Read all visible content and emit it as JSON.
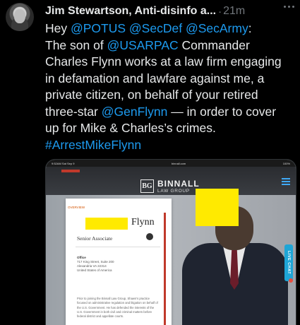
{
  "author": {
    "display_name": "Jim Stewartson, Anti-disinfo a...",
    "separator": "·",
    "time": "21m"
  },
  "tweet_lines": [
    [
      {
        "t": "Hey ",
        "m": false
      },
      {
        "t": "@POTUS",
        "m": true
      },
      {
        "t": " ",
        "m": false
      },
      {
        "t": "@SecDef",
        "m": true
      },
      {
        "t": " ",
        "m": false
      },
      {
        "t": "@SecArmy",
        "m": true
      },
      {
        "t": ":",
        "m": false
      }
    ],
    [
      {
        "t": "The son of ",
        "m": false
      },
      {
        "t": "@USARPAC",
        "m": true
      },
      {
        "t": " Commander",
        "m": false
      }
    ],
    [
      {
        "t": "Charles Flynn works at a law firm engaging",
        "m": false
      }
    ],
    [
      {
        "t": "in defamation and lawfare against me, a",
        "m": false
      }
    ],
    [
      {
        "t": "private citizen, on behalf of your retired",
        "m": false
      }
    ],
    [
      {
        "t": "three-star ",
        "m": false
      },
      {
        "t": "@GenFlynn",
        "m": true
      },
      {
        "t": " — in order to cover",
        "m": false
      }
    ],
    [
      {
        "t": "up for Mike & Charles’s crimes.",
        "m": false
      }
    ],
    [
      {
        "t": "#ArrestMikeFlynn",
        "m": true
      }
    ]
  ],
  "media": {
    "status_left": "9:52AM  Sat Sep 9",
    "status_center": "binnall.com",
    "status_right": "100%",
    "logo_mark": "BG",
    "logo_title": "BINNALL",
    "logo_subtitle": "LAW GROUP",
    "card_tag": "OVERVIEW",
    "surname": "Flynn",
    "role": "Senior Associate",
    "office_label": "Office",
    "office_lines": [
      "717 King Street, Suite 200",
      "Alexandria VA 22314",
      "United States of America"
    ],
    "bio": "Prior to joining the Binnall Law Group, Shawn's practice focused on administrative regulation and litigation on behalf of the U.S. Government. He has defended the interests of the U.S. Government in both civil and criminal matters before federal district and appellate courts.",
    "live_chat": "LIVE CHAT"
  },
  "colors": {
    "mention": "#1d9bf0",
    "text": "#e7e9ea",
    "muted": "#71767b",
    "redaction": "#ffea00"
  }
}
